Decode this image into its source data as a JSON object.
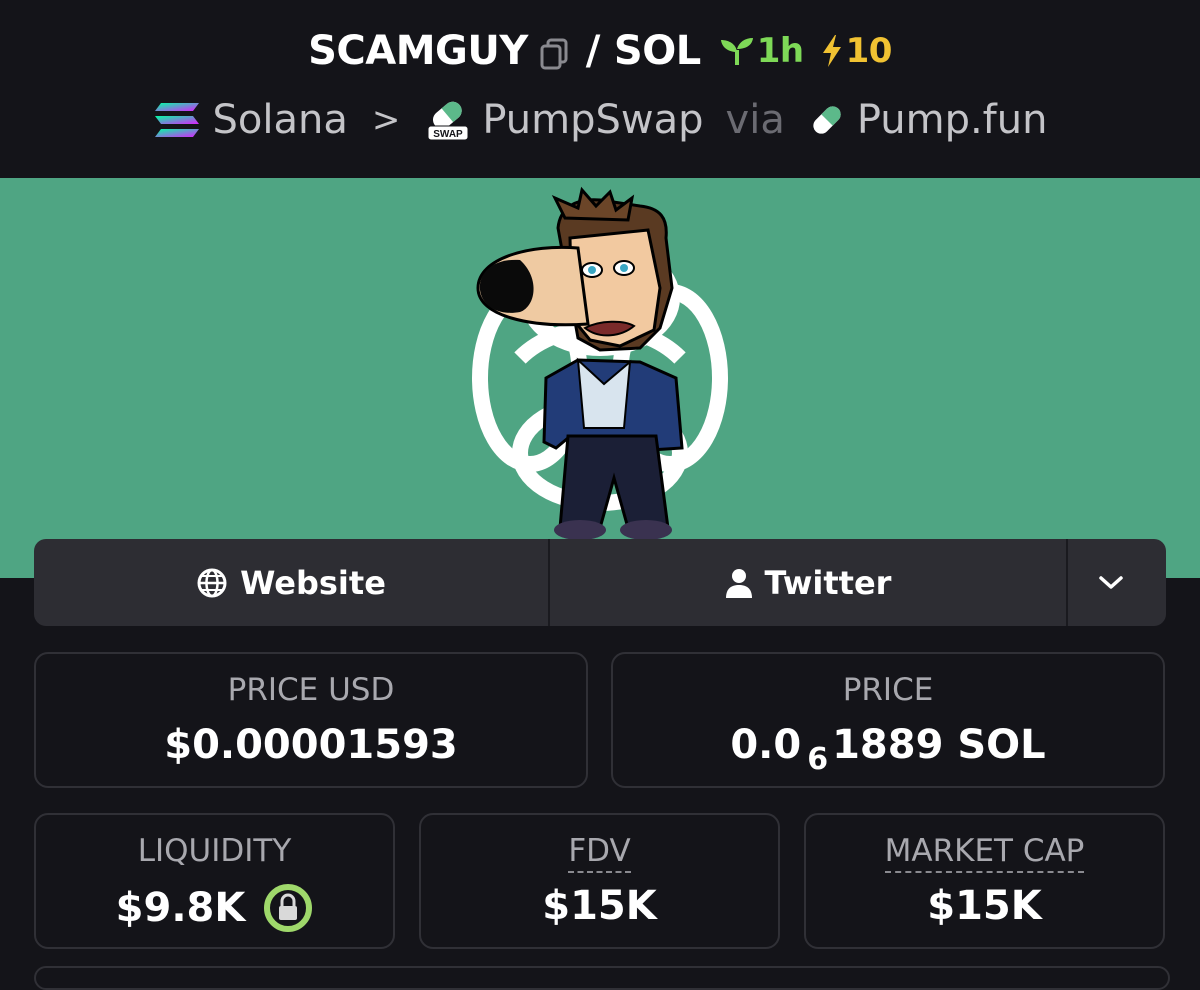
{
  "header": {
    "token_symbol": "SCAMGUY",
    "separator": "/",
    "quote_symbol": "SOL",
    "age": "1h",
    "boosts": "10",
    "chain": "Solana",
    "breadcrumb_sep": ">",
    "dex": "PumpSwap",
    "dex_badge": "SWAP",
    "via": "via",
    "launchpad": "Pump.fun"
  },
  "links": {
    "website": "Website",
    "twitter": "Twitter"
  },
  "stats": {
    "price_usd_label": "PRICE USD",
    "price_usd_value": "$0.00001593",
    "price_label": "PRICE",
    "price_prefix": "0.0",
    "price_zero_count": "6",
    "price_rest": "1889 SOL",
    "liquidity_label": "LIQUIDITY",
    "liquidity_value": "$9.8K",
    "fdv_label": "FDV",
    "fdv_value": "$15K",
    "mcap_label": "MARKET CAP",
    "mcap_value": "$15K"
  },
  "colors": {
    "background": "#141419",
    "banner": "#4fa583",
    "age_green": "#7ed957",
    "boost_yellow": "#f1c232",
    "liquidity_lock": "#9fd86b"
  },
  "icons": [
    "copy-icon",
    "sprout-icon",
    "lightning-icon",
    "solana-icon",
    "chevron-right-icon",
    "pumpswap-icon",
    "pill-icon",
    "globe-icon",
    "user-icon",
    "chevron-down-icon",
    "lock-icon"
  ]
}
